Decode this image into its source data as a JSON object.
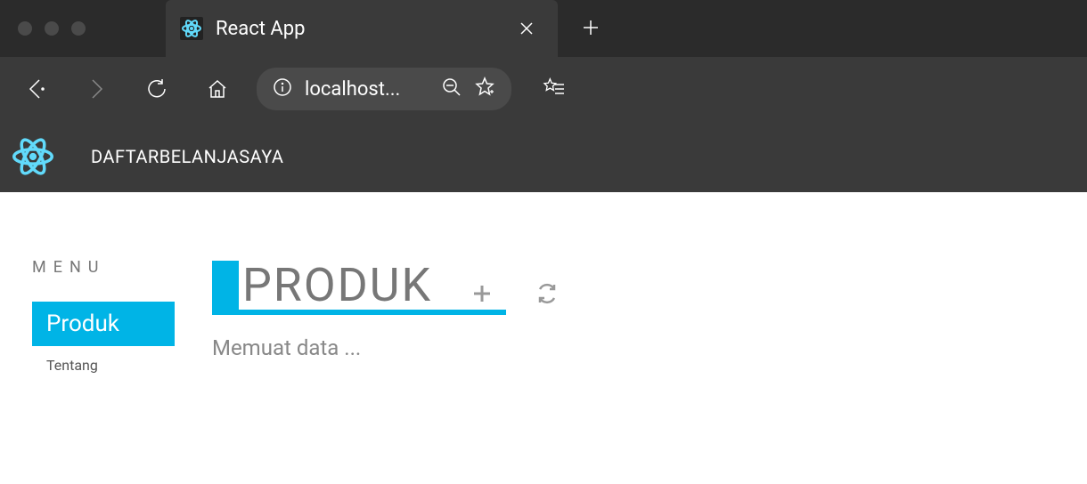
{
  "browser": {
    "tab_title": "React App",
    "new_tab_label": "+",
    "address": "localhost..."
  },
  "navbar": {
    "title": "DAFTARBELANJASAYA"
  },
  "sidebar": {
    "menu_label": "MENU",
    "items": [
      {
        "label": "Produk",
        "active": true
      },
      {
        "label": "Tentang",
        "active": false
      }
    ]
  },
  "main": {
    "title": "PRODUK",
    "status": "Memuat data ..."
  }
}
